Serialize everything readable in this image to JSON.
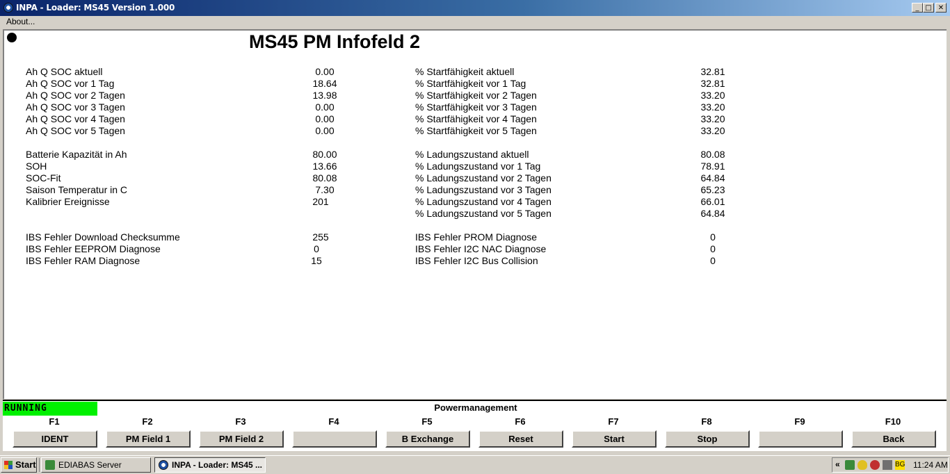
{
  "window": {
    "title": "INPA - Loader:  MS45 Version 1.000",
    "minimize_glyph": "_",
    "maximize_glyph": "□",
    "close_glyph": "✕"
  },
  "menu": {
    "about": "About..."
  },
  "page": {
    "title": "MS45 PM Infofeld 2"
  },
  "left_rows": [
    {
      "label": "Ah Q SOC aktuell",
      "value": "0.00"
    },
    {
      "label": "Ah Q SOC vor 1 Tag",
      "value": "18.64"
    },
    {
      "label": "Ah Q SOC vor 2 Tagen",
      "value": "13.98"
    },
    {
      "label": "Ah Q SOC vor 3 Tagen",
      "value": "0.00"
    },
    {
      "label": "Ah Q SOC vor 4 Tagen",
      "value": "0.00"
    },
    {
      "label": "Ah Q SOC vor 5 Tagen",
      "value": "0.00"
    },
    {
      "label": "Batterie Kapazität in Ah",
      "value": "80.00"
    },
    {
      "label": "SOH",
      "value": "13.66"
    },
    {
      "label": "SOC-Fit",
      "value": "80.08"
    },
    {
      "label": "Saison Temperatur in C",
      "value": "7.30"
    },
    {
      "label": "Kalibrier Ereignisse",
      "value": "201"
    },
    {
      "label": "IBS Fehler Download Checksumme",
      "value": "255"
    },
    {
      "label": "IBS Fehler EEPROM Diagnose",
      "value": "0"
    },
    {
      "label": "IBS Fehler RAM Diagnose",
      "value": "15"
    }
  ],
  "right_rows": [
    {
      "label": "% Startfähigkeit aktuell",
      "value": "32.81"
    },
    {
      "label": "% Startfähigkeit vor 1 Tag",
      "value": "32.81"
    },
    {
      "label": "% Startfähigkeit vor 2 Tagen",
      "value": "33.20"
    },
    {
      "label": "% Startfähigkeit vor 3 Tagen",
      "value": "33.20"
    },
    {
      "label": "% Startfähigkeit vor 4 Tagen",
      "value": "33.20"
    },
    {
      "label": "% Startfähigkeit vor 5 Tagen",
      "value": "33.20"
    },
    {
      "label": "% Ladungszustand aktuell",
      "value": "80.08"
    },
    {
      "label": "% Ladungszustand vor 1 Tag",
      "value": "78.91"
    },
    {
      "label": "% Ladungszustand vor 2 Tagen",
      "value": "64.84"
    },
    {
      "label": "% Ladungszustand vor 3 Tagen",
      "value": "65.23"
    },
    {
      "label": "% Ladungszustand vor 4 Tagen",
      "value": "66.01"
    },
    {
      "label": "% Ladungszustand vor 5 Tagen",
      "value": "64.84"
    },
    {
      "label": "IBS Fehler PROM Diagnose",
      "value": "0"
    },
    {
      "label": "IBS Fehler I2C NAC Diagnose",
      "value": "0"
    },
    {
      "label": "IBS Fehler I2C Bus Collision",
      "value": "0"
    }
  ],
  "status": {
    "text": "RUNNING",
    "color": "#00f000"
  },
  "section_label": "Powermanagement",
  "fkeys": [
    {
      "key": "F1",
      "label": "IDENT"
    },
    {
      "key": "F2",
      "label": "PM Field 1"
    },
    {
      "key": "F3",
      "label": "PM Field 2"
    },
    {
      "key": "F4",
      "label": ""
    },
    {
      "key": "F5",
      "label": "B Exchange"
    },
    {
      "key": "F6",
      "label": "Reset"
    },
    {
      "key": "F7",
      "label": "Start"
    },
    {
      "key": "F8",
      "label": "Stop"
    },
    {
      "key": "F9",
      "label": ""
    },
    {
      "key": "F10",
      "label": "Back"
    }
  ],
  "taskbar": {
    "start": "Start",
    "items": [
      {
        "label": "EDIABAS Server",
        "icon": "server-icon"
      },
      {
        "label": "INPA - Loader:  MS45 ...",
        "icon": "bmw-icon",
        "active": true
      }
    ],
    "tray_arrow": "«",
    "tray_badge": "BG",
    "clock": "11:24 AM"
  }
}
